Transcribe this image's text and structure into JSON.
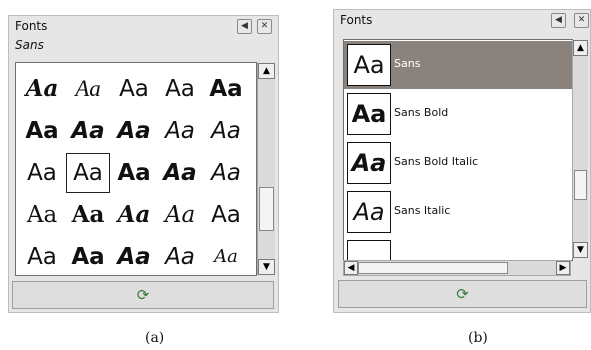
{
  "panel_a": {
    "title": "Fonts",
    "subtitle": "Sans",
    "grid_samples": [
      "Aa",
      "Aa",
      "Aa",
      "Aa",
      "Aa"
    ],
    "sample_text": "Aa",
    "caption": "(a)"
  },
  "panel_b": {
    "title": "Fonts",
    "preview_text": "Aa",
    "fonts": [
      {
        "name": "Sans",
        "selected": true
      },
      {
        "name": "Sans Bold",
        "selected": false
      },
      {
        "name": "Sans Bold Italic",
        "selected": false
      },
      {
        "name": "Sans Italic",
        "selected": false
      }
    ],
    "caption": "(b)"
  },
  "icons": {
    "tab_menu": "◀",
    "close": "✕",
    "scroll_up": "▲",
    "scroll_down": "▼",
    "scroll_left": "◀",
    "scroll_right": "▶",
    "refresh": "refresh-icon"
  },
  "refresh_glyph": "⟳"
}
